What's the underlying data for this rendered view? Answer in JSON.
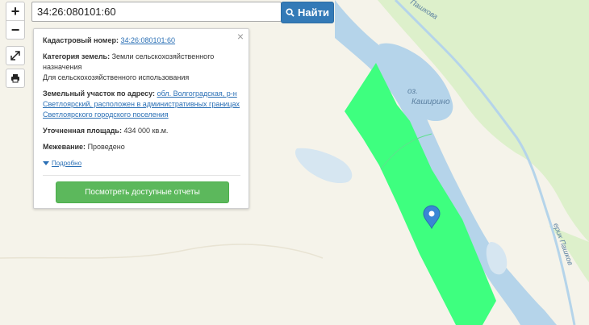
{
  "search": {
    "value": "34:26:080101:60",
    "button_label": "Найти"
  },
  "zoom": {
    "in_label": "+",
    "out_label": "−"
  },
  "map": {
    "lake_label_prefix": "оз.",
    "lake_label_name": "Каширино",
    "river_label_top": "Пашкова",
    "river_label_right": "ерик Пашков",
    "colors": {
      "parcel": "#3eff7f",
      "water": "#b5d4ea",
      "land": "#f5f3ea",
      "vegetation": "#ddf0cb",
      "marker": "#3a86d4"
    }
  },
  "popup": {
    "cadastral_label": "Кадастровый номер:",
    "cadastral_value": "34:26:080101:60",
    "category_label": "Категория земель:",
    "category_value": "Земли сельскохозяйственного назначения",
    "use_value": "Для сельскохозяйственного использования",
    "address_label": "Земельный участок по адресу:",
    "address_value": "обл. Волгоградская, р-н Светлоярский, расположен в административных границах Светлоярского городского поселения",
    "area_label": "Уточненная площадь:",
    "area_value": "434 000 кв.м.",
    "survey_label": "Межевание:",
    "survey_value": "Проведено",
    "details_label": "Подробно",
    "report_button": "Посмотреть доступные отчеты",
    "close_symbol": "×"
  }
}
